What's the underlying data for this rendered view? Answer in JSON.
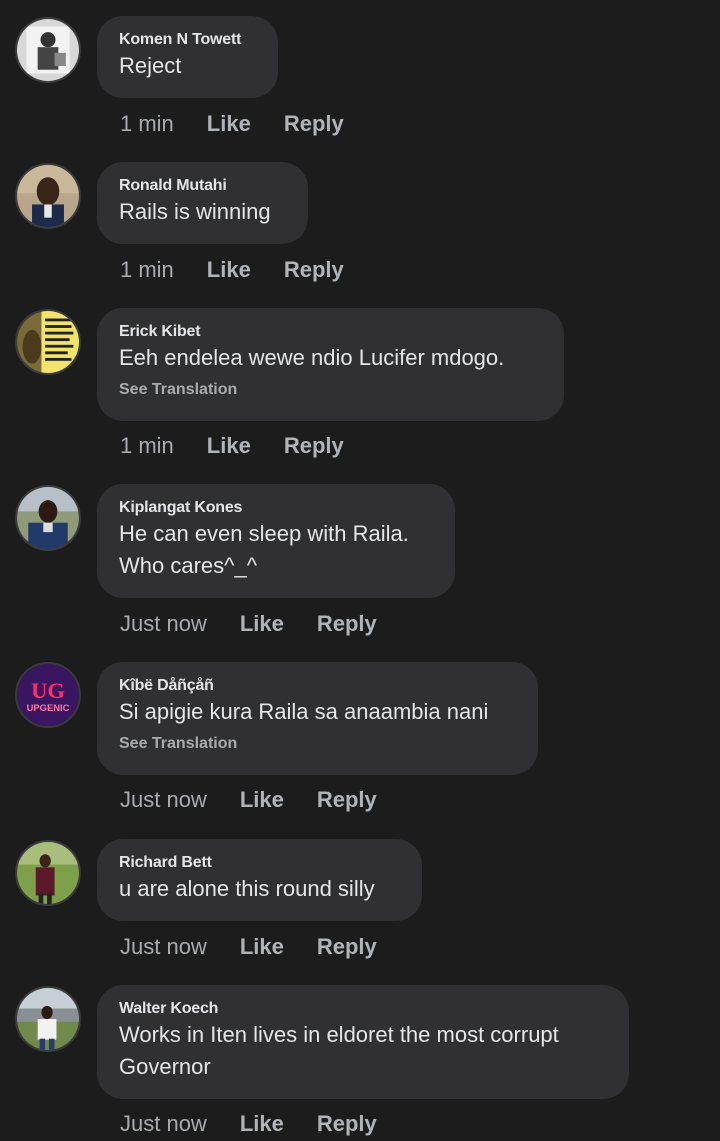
{
  "comments": [
    {
      "author": "Komen N Towett",
      "text": "Reject",
      "see_translation": "",
      "time": "1 min",
      "like": "Like",
      "reply": "Reply"
    },
    {
      "author": "Ronald Mutahi",
      "text": "Rails is winning",
      "see_translation": "",
      "time": "1 min",
      "like": "Like",
      "reply": "Reply"
    },
    {
      "author": "Erick Kibet",
      "text": "Eeh endelea wewe ndio Lucifer mdogo.",
      "see_translation": "See Translation",
      "time": "1 min",
      "like": "Like",
      "reply": "Reply"
    },
    {
      "author": "Kiplangat Kones",
      "text": "He can even sleep with Raila.\nWho cares^_^",
      "see_translation": "",
      "time": "Just now",
      "like": "Like",
      "reply": "Reply"
    },
    {
      "author": "Kîbë Dåñçåñ",
      "text": "Si apigie kura Raila sa anaambia nani",
      "see_translation": "See Translation",
      "time": "Just now",
      "like": "Like",
      "reply": "Reply",
      "avatar_logo": "UG",
      "avatar_brand": "UPGENIC"
    },
    {
      "author": "Richard Bett",
      "text": "u are alone this round silly",
      "see_translation": "",
      "time": "Just now",
      "like": "Like",
      "reply": "Reply"
    },
    {
      "author": "Walter Koech",
      "text": "Works in Iten lives in eldoret the most corrupt\nGovernor",
      "see_translation": "",
      "time": "Just now",
      "like": "Like",
      "reply": "Reply"
    }
  ],
  "colors": {
    "background": "#1c1c1d",
    "bubble": "#303032",
    "text": "#e4e6eb",
    "secondary_text": "#a8abaf"
  }
}
